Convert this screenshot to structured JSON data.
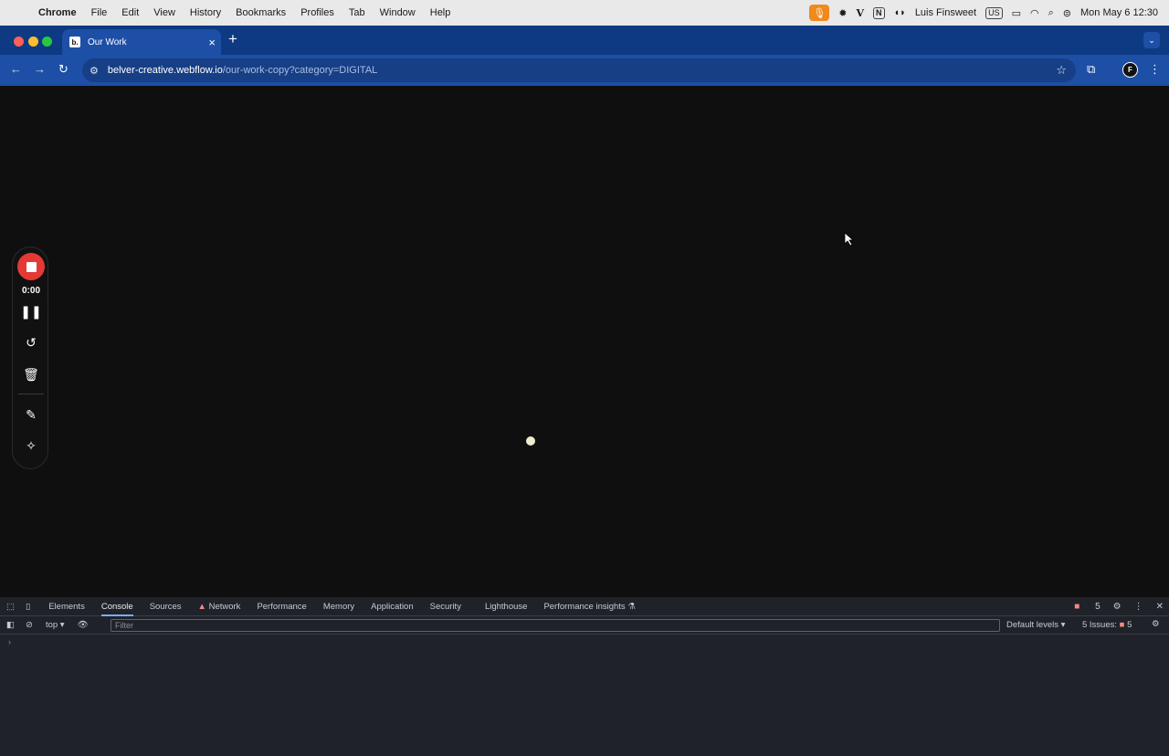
{
  "menubar": {
    "app": "Chrome",
    "items": [
      "File",
      "Edit",
      "View",
      "History",
      "Bookmarks",
      "Profiles",
      "Tab",
      "Window",
      "Help"
    ],
    "user": "Luis Finsweet",
    "keyboard": "US",
    "clock": "Mon May 6  12:30"
  },
  "browser": {
    "tab_title": "Our Work",
    "favicon": "b.",
    "url_host": "belver-creative.webflow.io",
    "url_path": "/our-work-copy?category=DIGITAL",
    "profile_initial": "F"
  },
  "recorder": {
    "time": "0:00"
  },
  "devtools": {
    "tabs": [
      "Elements",
      "Console",
      "Sources",
      "Network",
      "Performance",
      "Memory",
      "Application",
      "Security",
      "Lighthouse",
      "Performance insights"
    ],
    "active_tab": "Console",
    "error_count": "5",
    "context": "top",
    "filter_placeholder": "Filter",
    "levels": "Default levels",
    "issues_label": "5 Issues:",
    "issues_count": "5"
  },
  "colors": {
    "tabbar": "#0d3a82",
    "toolbar": "#1d4fa6",
    "page_bg": "#0f0f0f",
    "record": "#e53935",
    "mic": "#f08a1c"
  }
}
